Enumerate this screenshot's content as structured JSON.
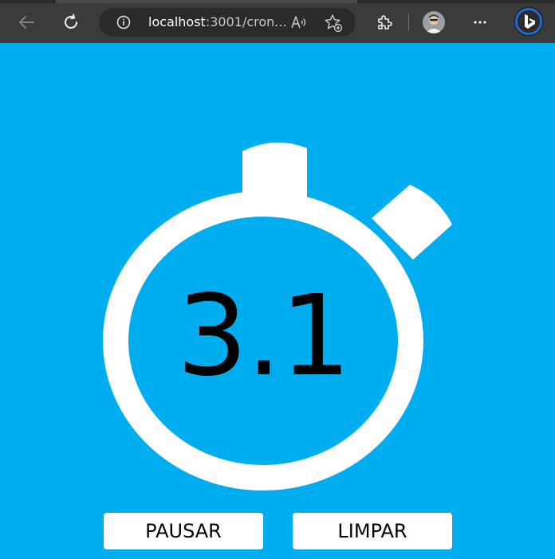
{
  "browser": {
    "url_host": "localhost",
    "url_rest": ":3001/cron...",
    "icons": [
      "back-icon",
      "refresh-icon",
      "info-icon",
      "read-aloud-icon",
      "add-favorite-icon",
      "extensions-icon",
      "profile-avatar",
      "more-icon",
      "bing-icon"
    ]
  },
  "stopwatch": {
    "time": "3.1",
    "background_color": "#00adef",
    "ring_color": "#ffffff"
  },
  "controls": {
    "pause_label": "PAUSAR",
    "clear_label": "LIMPAR"
  }
}
